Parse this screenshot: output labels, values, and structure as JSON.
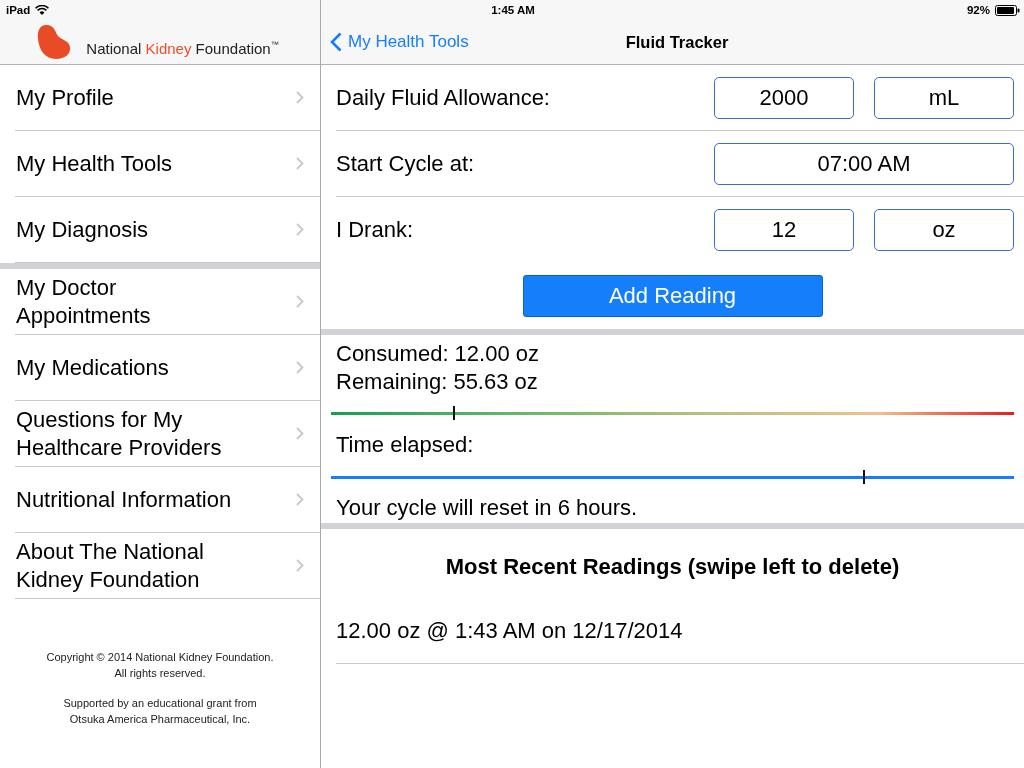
{
  "status_bar": {
    "device": "iPad",
    "time": "1:45 AM",
    "battery": "92%"
  },
  "sidebar": {
    "logo": {
      "before": "National",
      "accent": "Kidney",
      "after": "Foundation",
      "mark": "™"
    },
    "groups": [
      {
        "items": [
          {
            "label": "My Profile"
          },
          {
            "label": "My Health Tools"
          },
          {
            "label": "My Diagnosis"
          }
        ]
      },
      {
        "items": [
          {
            "label": "My Doctor Appointments"
          },
          {
            "label": "My Medications"
          },
          {
            "label": "Questions for My Healthcare Providers"
          },
          {
            "label": "Nutritional Information"
          },
          {
            "label": "About The National Kidney Foundation"
          }
        ]
      }
    ],
    "footer": [
      {
        "lines": [
          "Copyright © 2014 National Kidney Foundation.",
          "All rights reserved."
        ]
      },
      {
        "lines": [
          "Supported by an educational grant from",
          "Otsuka America Pharmaceutical, Inc."
        ]
      }
    ]
  },
  "nav": {
    "back": "My Health Tools",
    "title": "Fluid Tracker"
  },
  "form": {
    "rows": [
      {
        "label": "Daily Fluid Allowance:",
        "fields": [
          {
            "value": "2000"
          },
          {
            "value": "mL"
          }
        ]
      },
      {
        "label": "Start Cycle at:",
        "fields": [
          {
            "value": "07:00 AM"
          }
        ]
      },
      {
        "label": "I Drank:",
        "fields": [
          {
            "value": "12"
          },
          {
            "value": "oz"
          }
        ]
      }
    ],
    "button": "Add Reading"
  },
  "summary": {
    "consumed": "Consumed: 12.00 oz",
    "remaining": "Remaining: 55.63 oz",
    "consumption_meter": {
      "level": 0.18
    },
    "time_label": "Time elapsed:",
    "time_meter": {
      "level": 0.78
    },
    "reset_note": "Your cycle will reset in 6 hours."
  },
  "readings": {
    "title": "Most Recent Readings (swipe left to delete)",
    "rows": [
      {
        "text": "12.00 oz @ 1:43 AM on 12/17/2014"
      }
    ]
  }
}
